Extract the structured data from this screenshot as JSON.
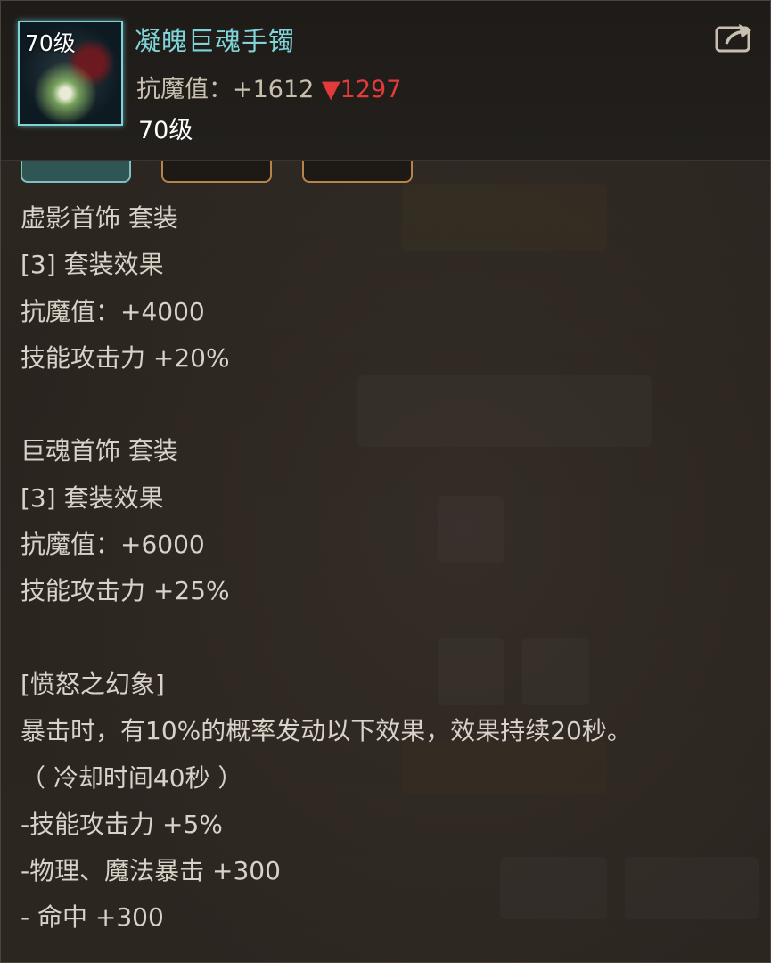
{
  "item": {
    "icon_level": "70级",
    "name": "凝魄巨魂手镯",
    "stat_label": "抗魔值：+1612 ",
    "stat_diff": "▼1297",
    "level": "70级"
  },
  "colors": {
    "name": "#7fd4d8",
    "decrease": "#e23b3b",
    "text": "#d9d2c8"
  },
  "icons": {
    "share": "share-export-icon"
  },
  "description": [
    "虚影首饰 套装",
    "[3] 套装效果",
    "抗魔值：+4000",
    "技能攻击力 +20%",
    "",
    "巨魂首饰 套装",
    "[3] 套装效果",
    "抗魔值：+6000",
    "技能攻击力 +25%",
    "",
    "[愤怒之幻象]",
    "暴击时，有10%的概率发动以下效果，效果持续20秒。",
    "（ 冷却时间40秒 ）",
    "-技能攻击力 +5%",
    "-物理、魔法暴击 +300",
    "- 命中 +300"
  ]
}
